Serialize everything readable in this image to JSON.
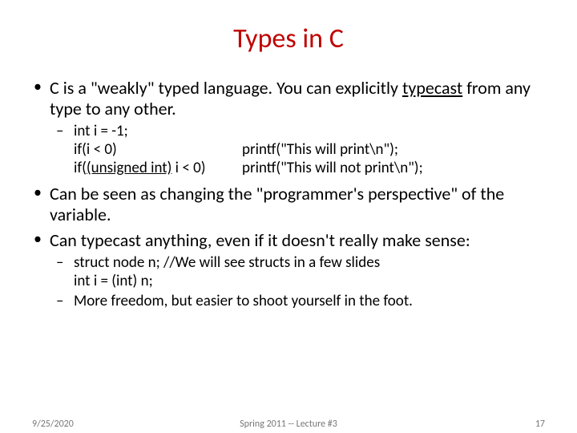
{
  "title": "Types in C",
  "bullets": {
    "b1a": "C is a \"weakly\" typed language. You can explicitly ",
    "b1_typecast": "typecast",
    "b1b": " from any type to any other.",
    "code": {
      "l1": "int i = -1;",
      "l2a": "if(i < 0)",
      "l2b": "printf(\"This will print\\n\");",
      "l3a_pre": "if(",
      "l3a_cast": "(unsigned int)",
      "l3a_post": " i < 0)",
      "l3b": "printf(\"This will not print\\n\");"
    },
    "b2": "Can be seen as changing the \"programmer's perspective\" of the variable.",
    "b3": "Can typecast anything, even if it doesn't really make sense:",
    "sub2": {
      "s1a": "struct node n; //We will see structs in a few slides",
      "s1b": "int i = (int) n;",
      "s2": "More freedom, but easier to shoot yourself in the foot."
    }
  },
  "footer": {
    "date": "9/25/2020",
    "mid": "Spring 2011 -- Lecture #3",
    "num": "17"
  }
}
